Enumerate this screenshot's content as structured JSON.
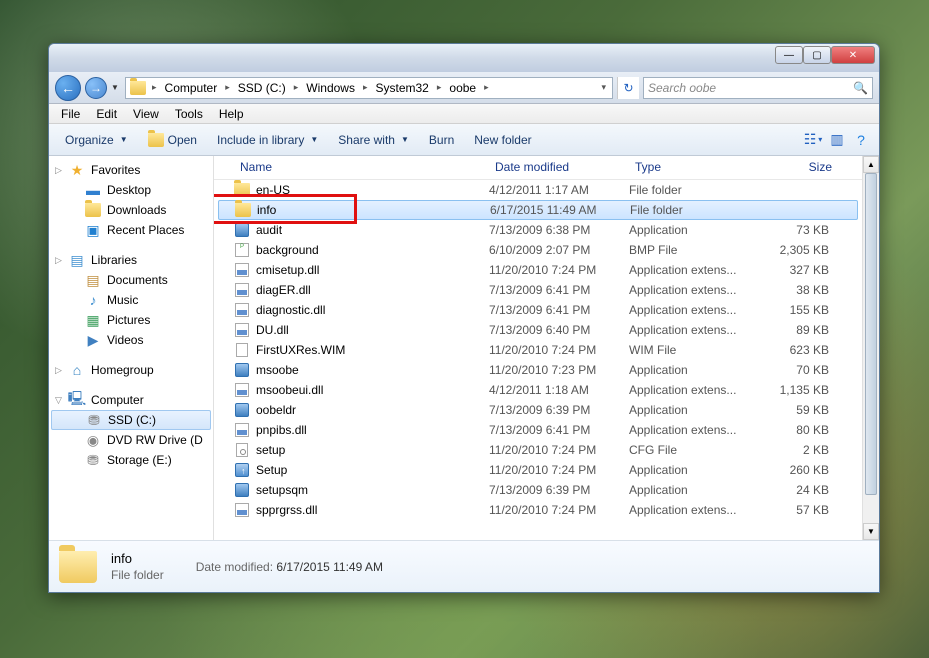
{
  "window": {
    "controls": {
      "min": "—",
      "max": "▢",
      "close": "✕"
    }
  },
  "address": {
    "segments": [
      "Computer",
      "SSD (C:)",
      "Windows",
      "System32",
      "oobe"
    ],
    "search_placeholder": "Search oobe"
  },
  "menu": [
    "File",
    "Edit",
    "View",
    "Tools",
    "Help"
  ],
  "toolbar": {
    "organize": "Organize",
    "open": "Open",
    "include": "Include in library",
    "share": "Share with",
    "burn": "Burn",
    "newfolder": "New folder"
  },
  "nav": {
    "favorites": {
      "label": "Favorites",
      "items": [
        "Desktop",
        "Downloads",
        "Recent Places"
      ]
    },
    "libraries": {
      "label": "Libraries",
      "items": [
        "Documents",
        "Music",
        "Pictures",
        "Videos"
      ]
    },
    "homegroup": {
      "label": "Homegroup"
    },
    "computer": {
      "label": "Computer",
      "items": [
        "SSD (C:)",
        "DVD RW Drive (D",
        "Storage (E:)"
      ]
    }
  },
  "columns": {
    "name": "Name",
    "date": "Date modified",
    "type": "Type",
    "size": "Size"
  },
  "files": [
    {
      "name": "en-US",
      "date": "4/12/2011 1:17 AM",
      "type": "File folder",
      "size": "",
      "icon": "folder"
    },
    {
      "name": "info",
      "date": "6/17/2015 11:49 AM",
      "type": "File folder",
      "size": "",
      "icon": "folder",
      "selected": true,
      "highlighted": true
    },
    {
      "name": "audit",
      "date": "7/13/2009 6:38 PM",
      "type": "Application",
      "size": "73 KB",
      "icon": "app"
    },
    {
      "name": "background",
      "date": "6/10/2009 2:07 PM",
      "type": "BMP File",
      "size": "2,305 KB",
      "icon": "bmp"
    },
    {
      "name": "cmisetup.dll",
      "date": "11/20/2010 7:24 PM",
      "type": "Application extens...",
      "size": "327 KB",
      "icon": "dll"
    },
    {
      "name": "diagER.dll",
      "date": "7/13/2009 6:41 PM",
      "type": "Application extens...",
      "size": "38 KB",
      "icon": "dll"
    },
    {
      "name": "diagnostic.dll",
      "date": "7/13/2009 6:41 PM",
      "type": "Application extens...",
      "size": "155 KB",
      "icon": "dll"
    },
    {
      "name": "DU.dll",
      "date": "7/13/2009 6:40 PM",
      "type": "Application extens...",
      "size": "89 KB",
      "icon": "dll"
    },
    {
      "name": "FirstUXRes.WIM",
      "date": "11/20/2010 7:24 PM",
      "type": "WIM File",
      "size": "623 KB",
      "icon": "file"
    },
    {
      "name": "msoobe",
      "date": "11/20/2010 7:23 PM",
      "type": "Application",
      "size": "70 KB",
      "icon": "app"
    },
    {
      "name": "msoobeui.dll",
      "date": "4/12/2011 1:18 AM",
      "type": "Application extens...",
      "size": "1,135 KB",
      "icon": "dll"
    },
    {
      "name": "oobeldr",
      "date": "7/13/2009 6:39 PM",
      "type": "Application",
      "size": "59 KB",
      "icon": "app"
    },
    {
      "name": "pnpibs.dll",
      "date": "7/13/2009 6:41 PM",
      "type": "Application extens...",
      "size": "80 KB",
      "icon": "dll"
    },
    {
      "name": "setup",
      "date": "11/20/2010 7:24 PM",
      "type": "CFG File",
      "size": "2 KB",
      "icon": "cfg"
    },
    {
      "name": "Setup",
      "date": "11/20/2010 7:24 PM",
      "type": "Application",
      "size": "260 KB",
      "icon": "setup"
    },
    {
      "name": "setupsqm",
      "date": "7/13/2009 6:39 PM",
      "type": "Application",
      "size": "24 KB",
      "icon": "app"
    },
    {
      "name": "spprgrss.dll",
      "date": "11/20/2010 7:24 PM",
      "type": "Application extens...",
      "size": "57 KB",
      "icon": "dll"
    }
  ],
  "details": {
    "name": "info",
    "type": "File folder",
    "meta_label": "Date modified:",
    "meta_value": "6/17/2015 11:49 AM"
  }
}
